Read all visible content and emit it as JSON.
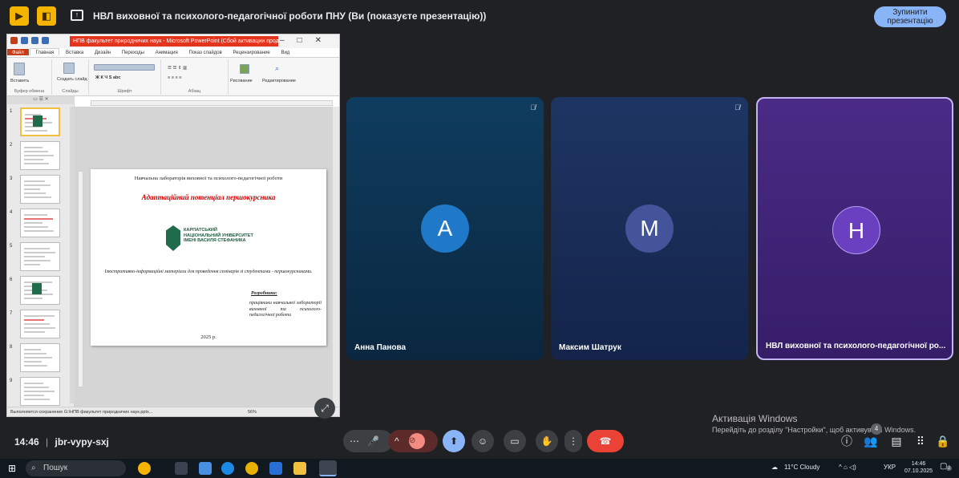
{
  "top_bar": {
    "title": "НВЛ виховної та психолого-педагогічної роботи ПНУ (Ви (показуєте презентацію))",
    "stop_line1": "Зупинити",
    "stop_line2": "презентацію"
  },
  "ppt": {
    "window_title": "НПВ факультет природничих наук - Microsoft PowerPoint (Сбой активации продук...",
    "tabs": [
      "Файл",
      "Главная",
      "Вставка",
      "Дизайн",
      "Переходы",
      "Анимация",
      "Показ слайдов",
      "Рецензирование",
      "Вид"
    ],
    "ribbon": {
      "paste": "Вставить",
      "clipboard": "Буфер обмена",
      "create_slide": "Создать слайд",
      "slides": "Слайды",
      "font": "Шрифт",
      "paragraph": "Абзац",
      "drawing": "Рисование",
      "editing": "Редактирование"
    },
    "thumb_numbers": [
      "1",
      "2",
      "3",
      "4",
      "5",
      "6",
      "7",
      "8",
      "9"
    ],
    "slide": {
      "lab": "Навчальна лабораторія виховної та психолого-педагогічної роботи",
      "title": "Адаптаційний потенціал першокурсника",
      "uni_line1": "КАРПАТСЬКИЙ",
      "uni_line2": "НАЦІОНАЛЬНИЙ УНІВЕРСИТЕТ",
      "uni_line3": "ІМЕНІ ВАСИЛЯ СТЕФАНИКА",
      "description": "Ілюстративно-інформаційні матеріали для проведення семінарів зі студентами - першокурсниками.",
      "developers_label": "Розробники:",
      "developers_text": "працівники навчальної лабораторії виховної та психолого-педагогічної роботи",
      "year": "2025 р."
    },
    "status": "Выполняется сохранение G:\\НПВ факультет природничих наук.pptx...",
    "zoom": "56%"
  },
  "tiles": [
    {
      "initial": "А",
      "name": "Анна Панова",
      "muted_icon": "mic-off-icon"
    },
    {
      "initial": "М",
      "name": "Максим Шатрук",
      "muted_icon": "mic-off-icon"
    },
    {
      "initial": "Н",
      "name": "НВЛ виховної та психолого-педагогічної ро...",
      "muted_icon": ""
    }
  ],
  "watermark": {
    "line1": "Активація Windows",
    "line2": "Перейдіть до розділу \"Настройки\", щоб активувати Windows."
  },
  "meeting": {
    "time": "14:46",
    "separator": "|",
    "code": "jbr-vypy-sxj",
    "participants_badge": "4"
  },
  "taskbar": {
    "search_placeholder": "Пошук",
    "weather": "11°C  Cloudy",
    "lang": "УКР",
    "clock_time": "14:46",
    "clock_date": "07.10.2025",
    "notif_count": "2"
  },
  "colors": {
    "accent_blue": "#8ab4f8",
    "end_call_red": "#ea4335",
    "ppt_red": "#c43e1c",
    "slide_title_red": "#d10000"
  }
}
